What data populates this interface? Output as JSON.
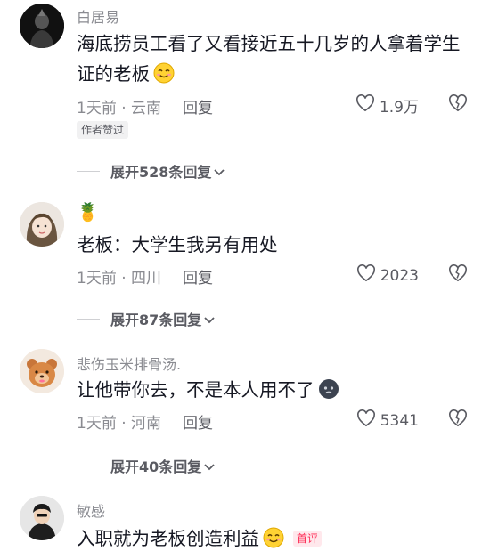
{
  "comments": [
    {
      "username": "白居易",
      "text": "海底捞员工看了又看接近五十几岁的人拿着学生证的老板",
      "emoji": "smiling-face-emoji",
      "time_location": "1天前 · 云南",
      "reply_label": "回复",
      "likes": "1.9万",
      "author_tag": "作者赞过",
      "expand_label": "展开528条回复"
    },
    {
      "username": "🍍",
      "text": "老板：大学生我另有用处",
      "time_location": "1天前 · 四川",
      "reply_label": "回复",
      "likes": "2023",
      "expand_label": "展开87条回复"
    },
    {
      "username": "悲伤玉米排骨汤.",
      "text": "让他带你去，不是本人用不了",
      "emoji": "dark-blob-emoji",
      "time_location": "1天前 · 河南",
      "reply_label": "回复",
      "likes": "5341",
      "expand_label": "展开40条回复"
    },
    {
      "username": "敏感",
      "text": "入职就为老板创造利益",
      "emoji": "smiling-face-emoji",
      "badge": "首评"
    }
  ]
}
